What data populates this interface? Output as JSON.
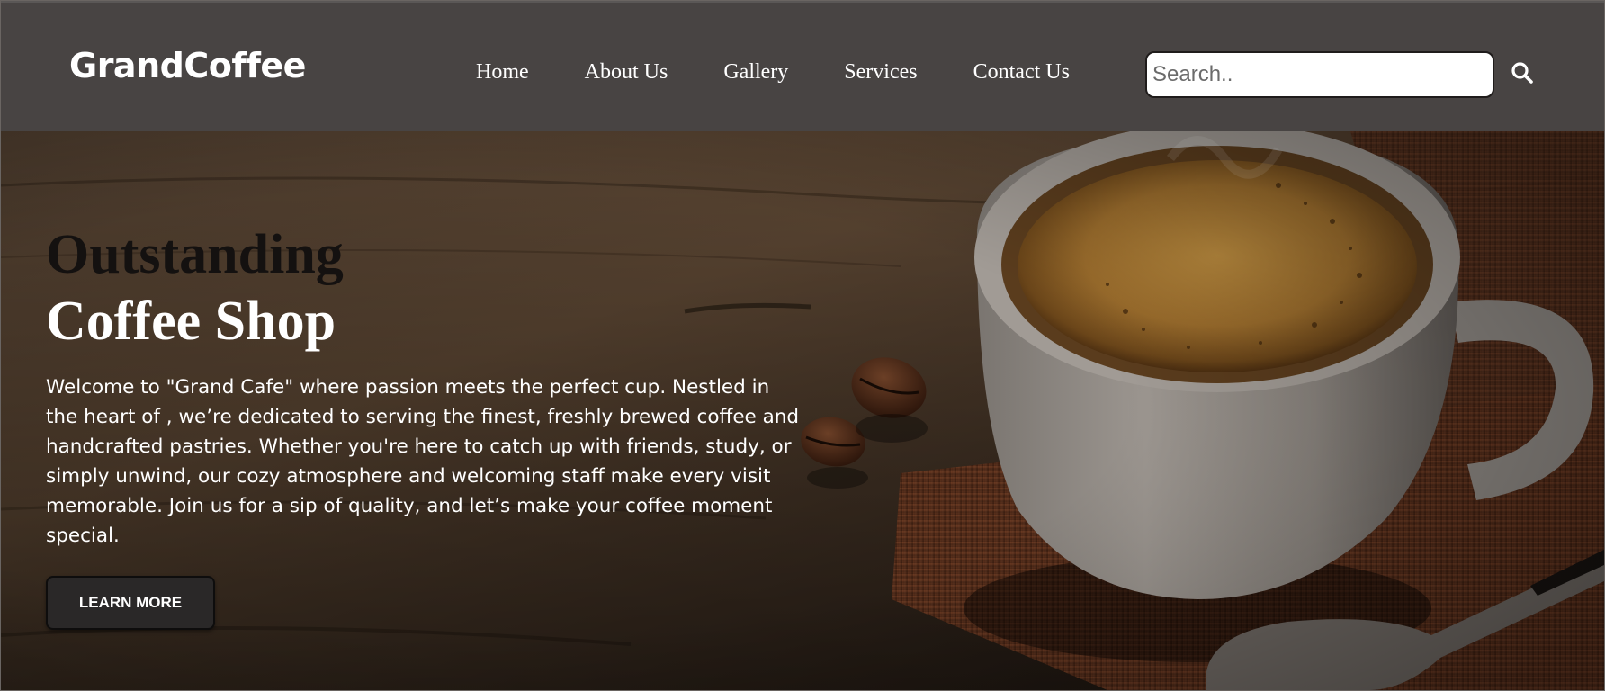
{
  "header": {
    "logo": "GrandCoffee",
    "nav": [
      {
        "label": "Home"
      },
      {
        "label": "About Us"
      },
      {
        "label": "Gallery"
      },
      {
        "label": "Services"
      },
      {
        "label": "Contact Us"
      }
    ],
    "search": {
      "placeholder": "Search..",
      "value": "",
      "icon": "search-icon"
    }
  },
  "hero": {
    "title_line1": "Outstanding",
    "title_line2": "Coffee Shop",
    "description": "Welcome to \"Grand Cafe\" where passion meets the perfect cup. Nestled in the heart of , we’re dedicated to serving the finest, freshly brewed coffee and handcrafted pastries. Whether you're here to catch up with friends, study, or simply unwind, our cozy atmosphere and welcoming staff make every visit memorable. Join us for a sip of quality, and let’s make your coffee moment special.",
    "cta_label": "LEARN MORE"
  },
  "colors": {
    "header_bg": "#484443",
    "button_bg": "#2a2828",
    "text_light": "#ffffff",
    "title_dark": "#141110"
  }
}
